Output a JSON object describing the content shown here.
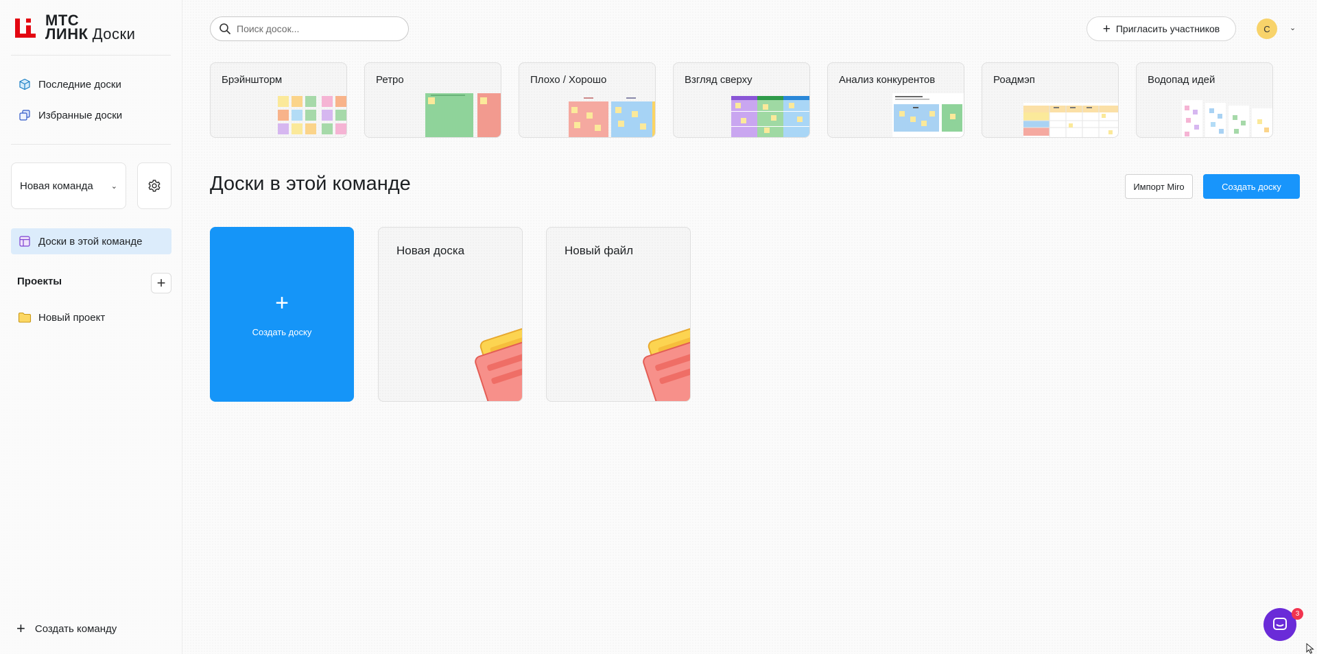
{
  "brand": {
    "line1": "МТС",
    "line2": "ЛИНК",
    "product": "Доски",
    "accent_color": "#e30611"
  },
  "sidebar": {
    "nav": [
      {
        "label": "Последние доски",
        "icon": "cube-icon"
      },
      {
        "label": "Избранные доски",
        "icon": "stack-icon"
      }
    ],
    "team": {
      "selected": "Новая команда"
    },
    "active_item": {
      "label": "Доски в этой команде",
      "icon": "board-layout-icon"
    },
    "projects": {
      "title": "Проекты",
      "items": [
        {
          "label": "Новый проект",
          "icon": "folder-icon"
        }
      ]
    },
    "create_team_label": "Создать команду"
  },
  "header": {
    "search_placeholder": "Поиск досок...",
    "invite_label": "Пригласить участников",
    "avatar_initial": "С"
  },
  "templates": [
    {
      "label": "Брэйншторм"
    },
    {
      "label": "Ретро"
    },
    {
      "label": "Плохо / Хорошо"
    },
    {
      "label": "Взгляд сверху"
    },
    {
      "label": "Анализ конкурентов"
    },
    {
      "label": "Роадмэп"
    },
    {
      "label": "Водопад идей"
    }
  ],
  "main": {
    "title": "Доски в этой команде",
    "import_label": "Импорт Miro",
    "create_label": "Создать доску",
    "create_card_label": "Создать доску",
    "boards": [
      {
        "label": "Новая доска"
      },
      {
        "label": "Новый файл"
      }
    ]
  },
  "chat": {
    "badge_count": "3",
    "color": "#6a2bd8"
  },
  "colors": {
    "primary": "#1895fb",
    "active_bg": "#dcecfb"
  }
}
